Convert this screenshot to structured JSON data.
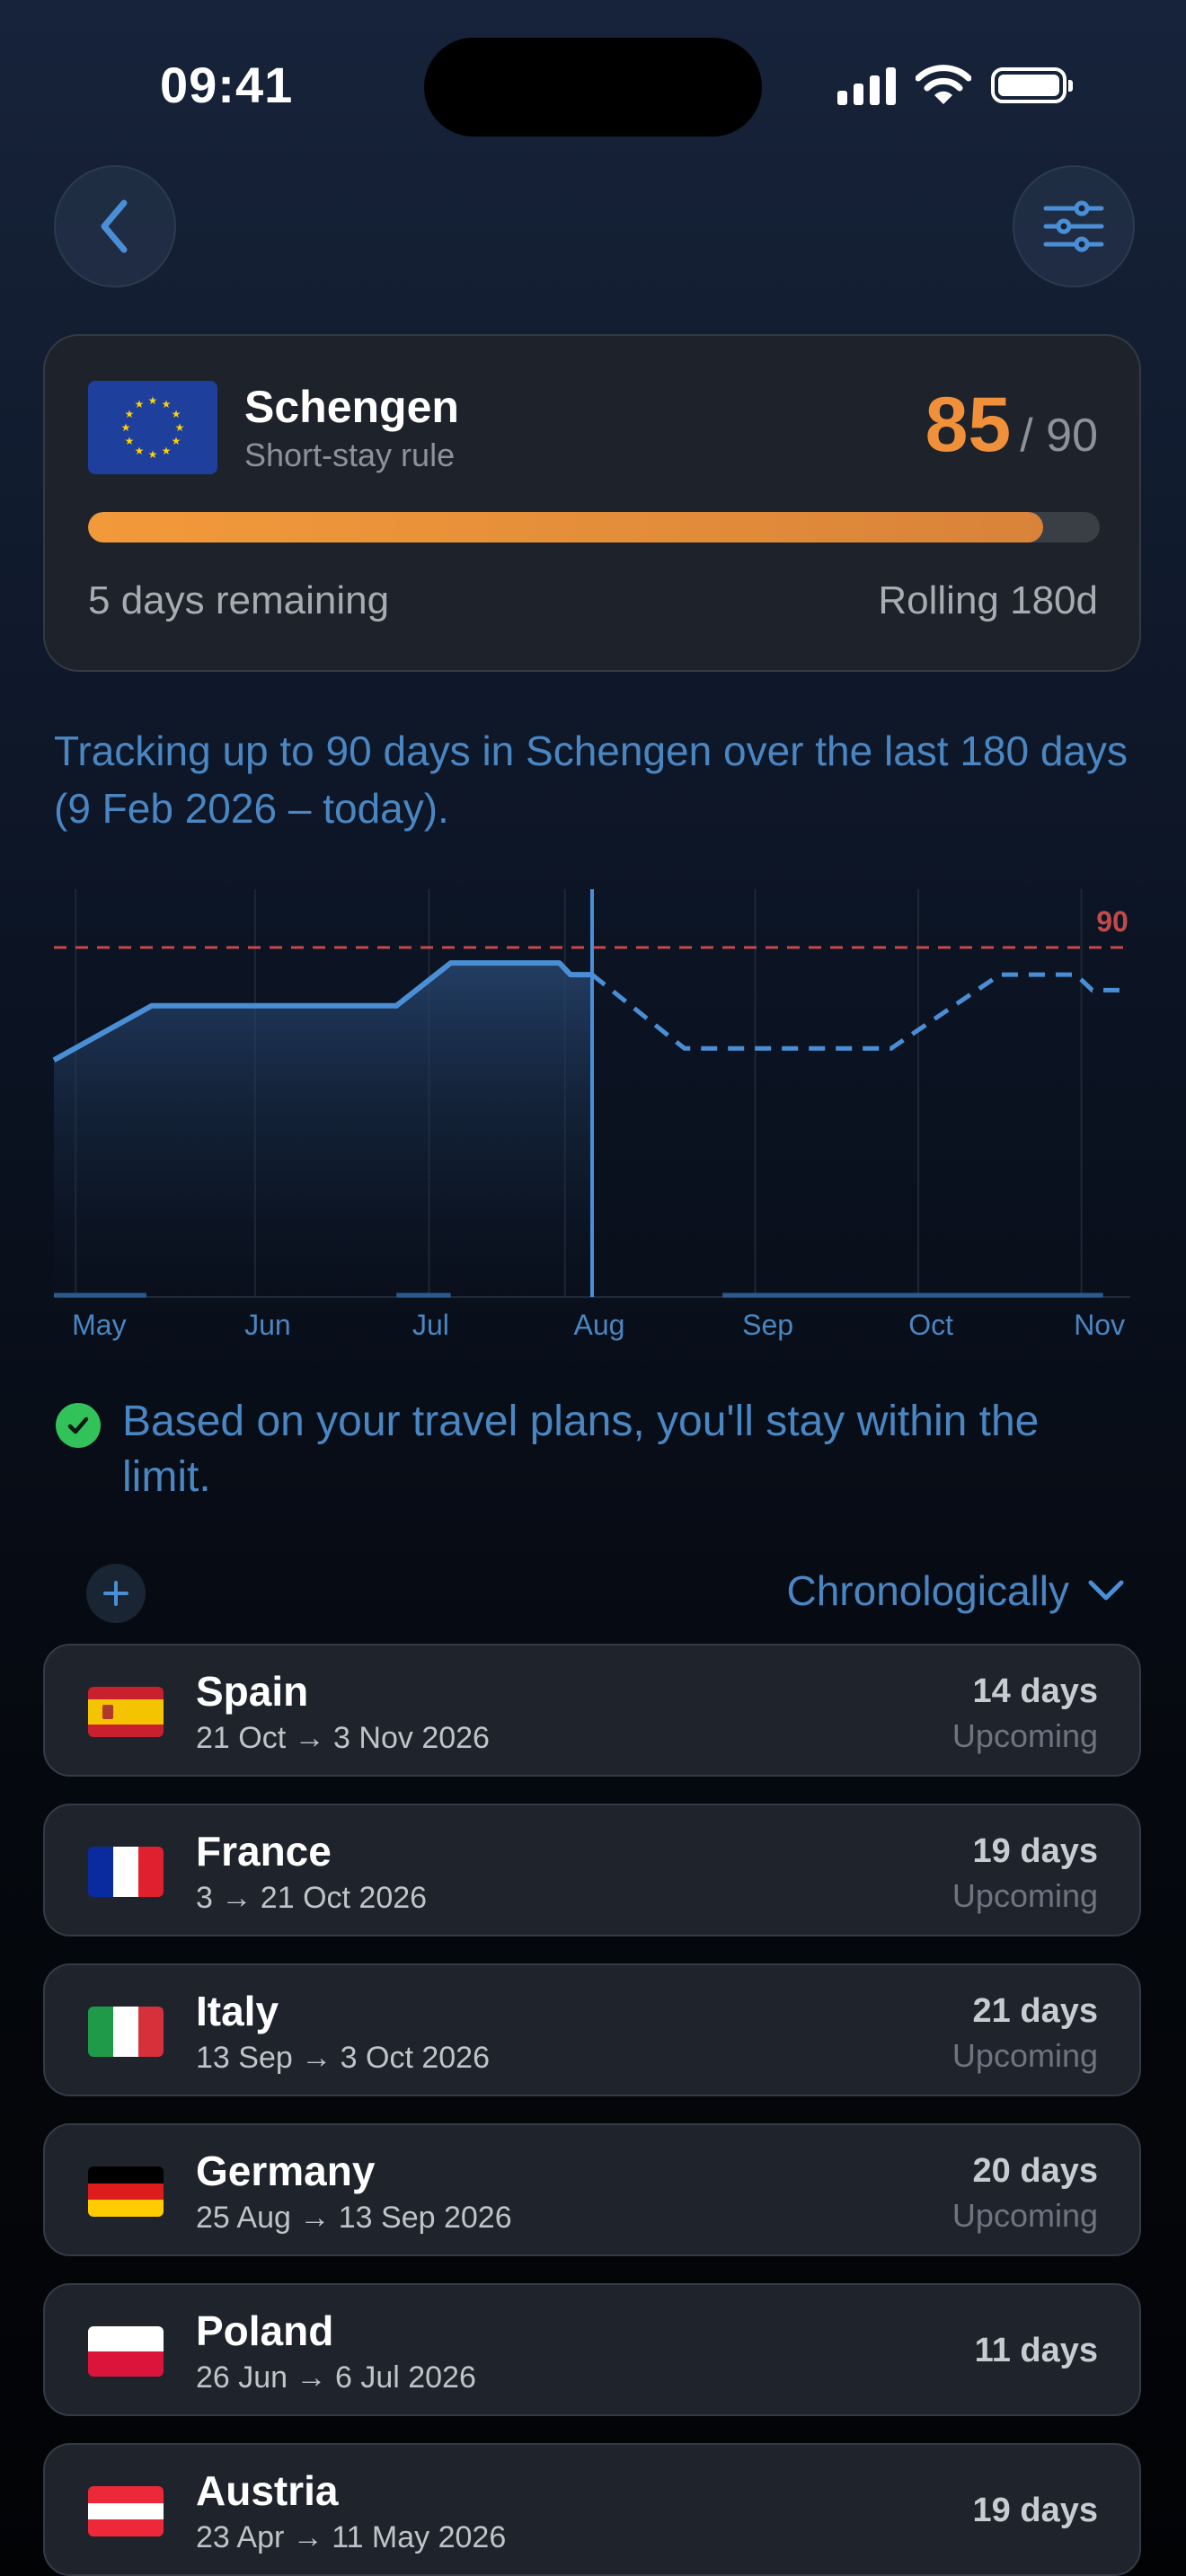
{
  "status_bar": {
    "time": "09:41"
  },
  "nav": {
    "back_icon": "chevron-left-icon",
    "filter_icon": "sliders-icon"
  },
  "zone": {
    "name": "Schengen",
    "rule": "Short-stay rule",
    "days_used": "85",
    "days_limit": "/ 90",
    "progress_fraction": 0.944,
    "remaining": "5 days remaining",
    "window": "Rolling 180d",
    "accent_color": "#f0903a"
  },
  "tracking_text": "Tracking up to 90 days in Schengen over the last 180 days (9 Feb 2026 – today).",
  "chart_data": {
    "type": "line",
    "limit_label": "90",
    "limit": 90,
    "ylim": [
      0,
      105
    ],
    "x_ticks": [
      "May",
      "Jun",
      "Jul",
      "Aug",
      "Sep",
      "Oct",
      "Nov"
    ],
    "today": "2026-08-01",
    "actual": {
      "x": [
        "2026-04-24",
        "2026-05-12",
        "2026-06-26",
        "2026-07-06",
        "2026-07-26",
        "2026-07-28",
        "2026-08-01"
      ],
      "y": [
        61,
        75,
        75,
        86,
        86,
        83,
        83
      ]
    },
    "projected": {
      "x": [
        "2026-08-01",
        "2026-08-18",
        "2026-09-25",
        "2026-10-15",
        "2026-10-29",
        "2026-11-01",
        "2026-11-06"
      ],
      "y": [
        83,
        64,
        64,
        83,
        83,
        79,
        79
      ]
    },
    "colors": {
      "line": "#4a8fd6",
      "limit": "#c24a48"
    }
  },
  "status_message": "Based on your travel plans, you'll stay within the limit.",
  "controls": {
    "add_icon": "plus-icon",
    "sort_label": "Chronologically",
    "sort_icon": "chevron-down-icon"
  },
  "trips": [
    {
      "country": "Spain",
      "dates": "21 Oct → 3 Nov 2026",
      "days": "14 days",
      "status": "Upcoming",
      "flag": "spain-flag"
    },
    {
      "country": "France",
      "dates": "3 → 21 Oct 2026",
      "days": "19 days",
      "status": "Upcoming",
      "flag": "france-flag"
    },
    {
      "country": "Italy",
      "dates": "13 Sep → 3 Oct 2026",
      "days": "21 days",
      "status": "Upcoming",
      "flag": "italy-flag"
    },
    {
      "country": "Germany",
      "dates": "25 Aug → 13 Sep 2026",
      "days": "20 days",
      "status": "Upcoming",
      "flag": "germany-flag"
    },
    {
      "country": "Poland",
      "dates": "26 Jun → 6 Jul 2026",
      "days": "11 days",
      "status": "",
      "flag": "poland-flag"
    },
    {
      "country": "Austria",
      "dates": "23 Apr → 11 May 2026",
      "days": "19 days",
      "status": "",
      "flag": "austria-flag"
    }
  ]
}
